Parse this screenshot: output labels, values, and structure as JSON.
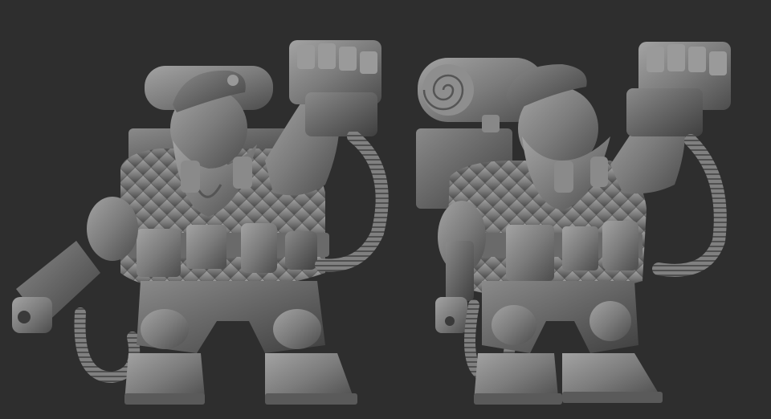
{
  "scene": {
    "background_color": "#2e2e2e",
    "material_color": "#7d7d7d",
    "shadow_color": "#4a4a4a",
    "highlight_color": "#a8a8a8",
    "views": [
      {
        "id": "three-quarter-left",
        "icon": "dwarf-figure-sculpt"
      },
      {
        "id": "three-quarter-right",
        "icon": "dwarf-figure-sculpt"
      }
    ]
  }
}
